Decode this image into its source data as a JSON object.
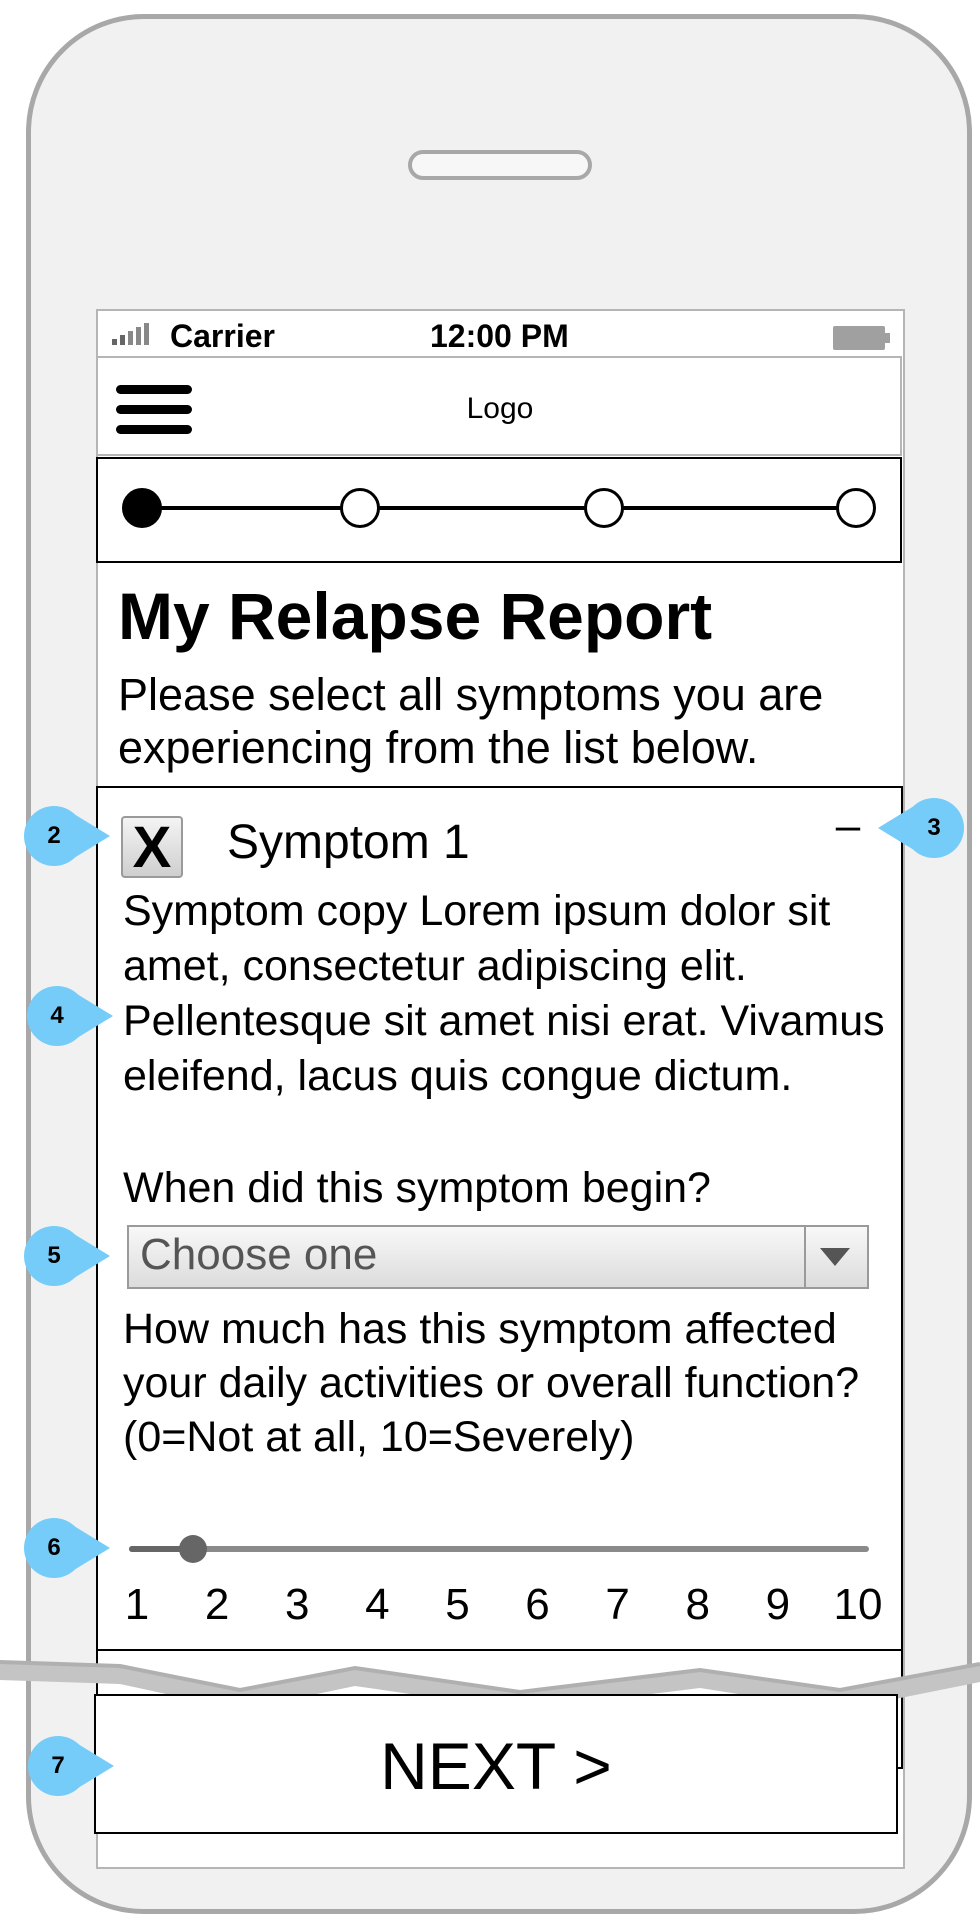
{
  "status_bar": {
    "carrier": "Carrier",
    "time": "12:00 PM"
  },
  "navbar": {
    "logo": "Logo",
    "menu_icon": "hamburger-icon"
  },
  "progress": {
    "steps": 4,
    "current_step": 1
  },
  "page": {
    "title": "My Relapse Report",
    "instructions": "Please select all symptoms you are experiencing from the list below."
  },
  "symptom": {
    "checkbox_mark": "X",
    "checked": true,
    "title": "Symptom 1",
    "collapse_symbol": "–",
    "copy": "Symptom copy Lorem ipsum dolor sit amet, consectetur adipiscing elit. Pellentesque sit amet nisi erat. Vivamus eleifend, lacus quis congue dictum.",
    "begin_question": "When did this symptom begin?",
    "begin_select": {
      "value": "Choose one"
    },
    "impact_question": "How much has this symptom affected your daily activities or overall function? (0=Not at all, 10=Severely)",
    "slider": {
      "min": 1,
      "max": 10,
      "value": 1.7,
      "ticks": [
        "1",
        "2",
        "3",
        "4",
        "5",
        "6",
        "7",
        "8",
        "9",
        "10"
      ]
    }
  },
  "next_button": {
    "label": "NEXT >"
  },
  "callouts": [
    "2",
    "3",
    "4",
    "5",
    "6",
    "7"
  ],
  "colors": {
    "callout": "#76ccf8",
    "phone_frame": "#a8a8a8"
  }
}
